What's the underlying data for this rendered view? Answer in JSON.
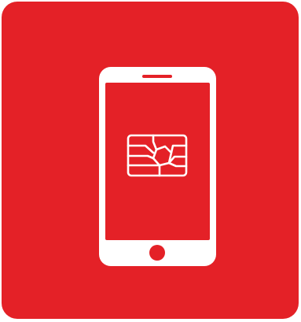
{
  "icon": {
    "name": "smartphone-sim-card-icon",
    "colors": {
      "background": "#E42127",
      "foreground": "#FFFFFF",
      "page": "#FFFFFF"
    },
    "elements": [
      "phone-outline-icon",
      "speaker-slot",
      "sim-chip-icon",
      "home-button"
    ]
  }
}
